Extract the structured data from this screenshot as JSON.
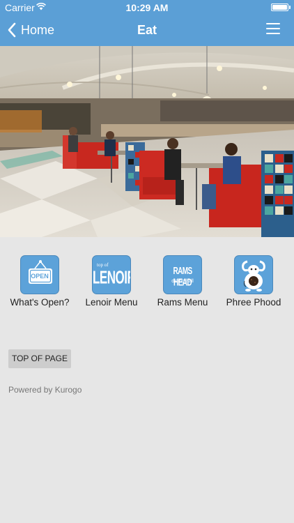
{
  "status_bar": {
    "carrier": "Carrier",
    "time": "10:29 AM"
  },
  "nav": {
    "back_label": "Home",
    "title": "Eat"
  },
  "modules": [
    {
      "label": "What's Open?",
      "icon": "open-sign-icon",
      "icon_text": "OPEN"
    },
    {
      "label": "Lenoir Menu",
      "icon": "lenoir-logo-icon",
      "icon_text_small": "top of",
      "icon_text": "LENOIR"
    },
    {
      "label": "Rams Menu",
      "icon": "rams-head-logo-icon",
      "icon_text": "RAMS HEAD",
      "icon_text_small": "dining hall"
    },
    {
      "label": "Phree Phood",
      "icon": "ram-mascot-icon"
    }
  ],
  "footer": {
    "top_button": "TOP OF PAGE",
    "powered_by": "Powered by Kurogo"
  },
  "colors": {
    "nav_bar": "#5b9fd6",
    "tile_bg": "#5ca2d9",
    "page_bg": "#e6e6e6"
  }
}
